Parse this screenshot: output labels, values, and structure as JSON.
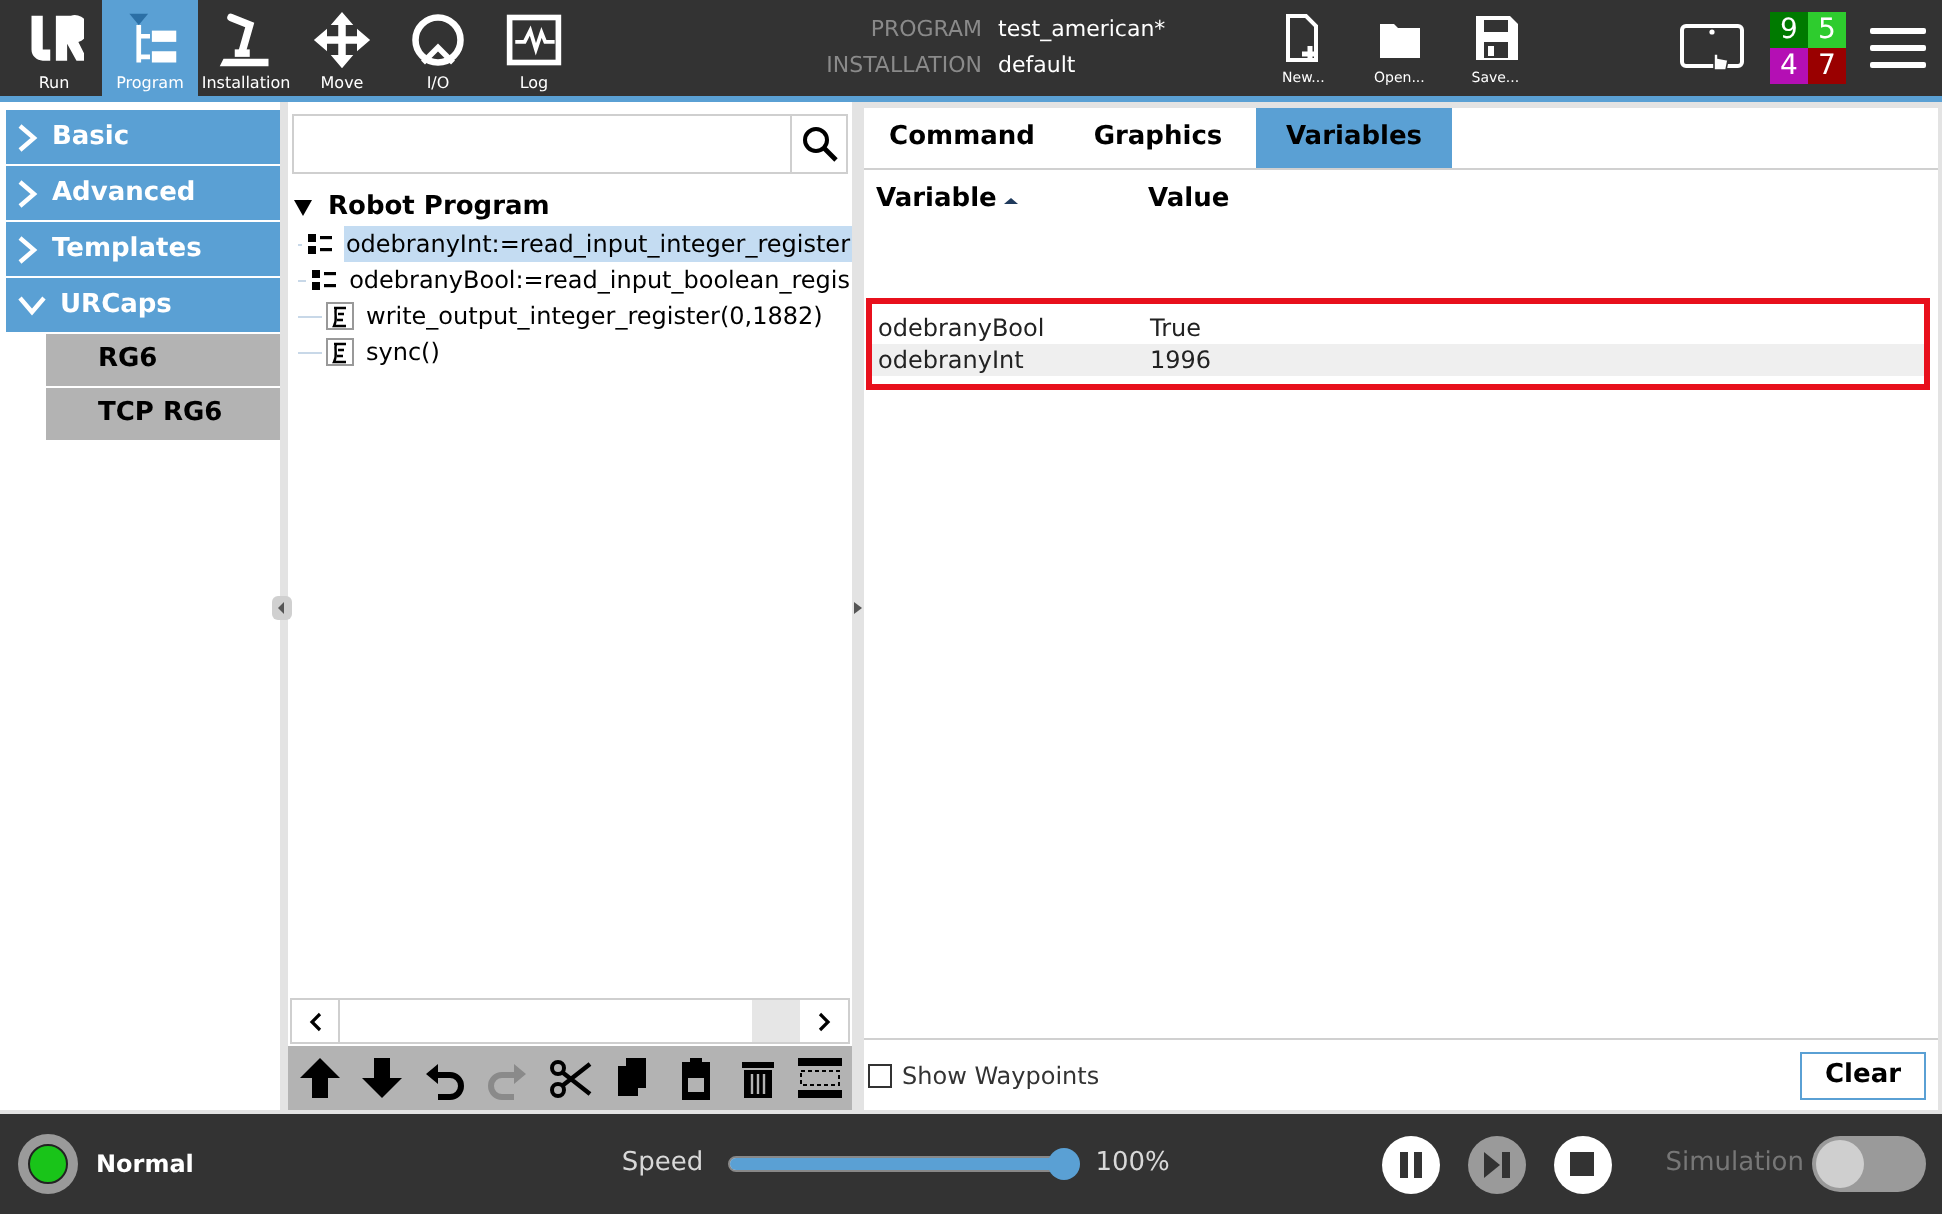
{
  "nav_tabs": [
    {
      "label": "Run",
      "kind": "logo",
      "selected": false
    },
    {
      "label": "Program",
      "kind": "program",
      "selected": true
    },
    {
      "label": "Installation",
      "kind": "arm",
      "selected": false
    },
    {
      "label": "Move",
      "kind": "move",
      "selected": false
    },
    {
      "label": "I/O",
      "kind": "io",
      "selected": false
    },
    {
      "label": "Log",
      "kind": "log",
      "selected": false
    }
  ],
  "program_info": [
    {
      "label": "PROGRAM",
      "value": "test_american*"
    },
    {
      "label": "INSTALLATION",
      "value": "default"
    }
  ],
  "file_buttons": [
    {
      "label": "New...",
      "kind": "new"
    },
    {
      "label": "Open...",
      "kind": "open"
    },
    {
      "label": "Save...",
      "kind": "save"
    }
  ],
  "counters": [
    {
      "value": "9",
      "color": "#007a00"
    },
    {
      "value": "5",
      "color": "#2ecc2e"
    },
    {
      "value": "4",
      "color": "#b40fb4"
    },
    {
      "value": "7",
      "color": "#9a0000"
    }
  ],
  "sidebar": {
    "items": [
      {
        "label": "Basic",
        "expanded": false
      },
      {
        "label": "Advanced",
        "expanded": false
      },
      {
        "label": "Templates",
        "expanded": false
      },
      {
        "label": "URCaps",
        "expanded": true,
        "children": [
          {
            "label": "RG6"
          },
          {
            "label": "TCP RG6"
          }
        ]
      }
    ]
  },
  "tree": {
    "root": {
      "label": "Robot Program",
      "expanded": true,
      "children": [
        {
          "label": "odebranyInt:=read_input_integer_register",
          "kind": "assignment",
          "selected": true
        },
        {
          "label": "odebranyBool:=read_input_boolean_regis",
          "kind": "assignment",
          "selected": false
        },
        {
          "label": "write_output_integer_register(0,1882)",
          "kind": "script",
          "selected": false
        },
        {
          "label": "sync()",
          "kind": "script",
          "selected": false
        }
      ]
    }
  },
  "tree_toolbar": [
    {
      "kind": "up",
      "disabled": false
    },
    {
      "kind": "down",
      "disabled": false
    },
    {
      "kind": "undo",
      "disabled": false
    },
    {
      "kind": "redo",
      "disabled": true
    },
    {
      "kind": "cut",
      "disabled": false
    },
    {
      "kind": "copy",
      "disabled": false
    },
    {
      "kind": "paste",
      "disabled": false
    },
    {
      "kind": "delete",
      "disabled": false
    },
    {
      "kind": "suppress",
      "disabled": false
    }
  ],
  "tabs": [
    {
      "label": "Command",
      "selected": false
    },
    {
      "label": "Graphics",
      "selected": false
    },
    {
      "label": "Variables",
      "selected": true
    }
  ],
  "variables": {
    "columns": [
      "Variable",
      "Value"
    ],
    "rows": [
      {
        "name": "odebranyBool",
        "value": "True"
      },
      {
        "name": "odebranyInt",
        "value": "1996"
      }
    ]
  },
  "show_waypoints": {
    "label": "Show Waypoints",
    "checked": false
  },
  "clear_button": "Clear",
  "status_bar": {
    "state": "Normal",
    "color": "#19c419",
    "speed_label": "Speed",
    "speed": {
      "level": 1.0
    },
    "speed_reading": "100%",
    "simulation_label": "Simulation",
    "simulation_on": false
  }
}
